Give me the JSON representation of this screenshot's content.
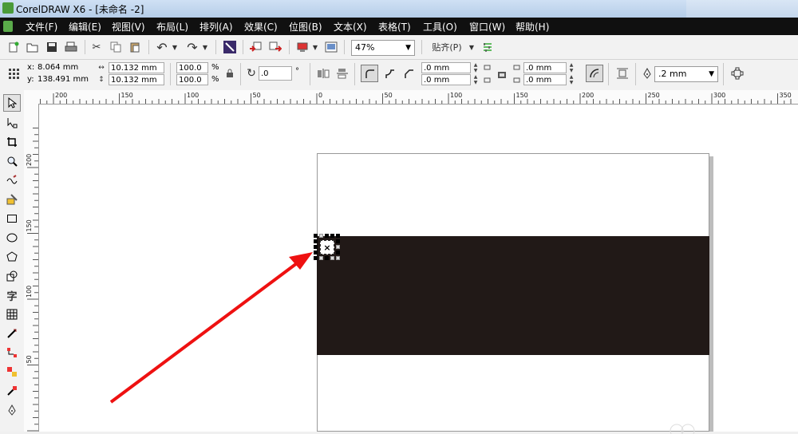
{
  "window": {
    "title": "CorelDRAW X6 - [未命名 -2]"
  },
  "menu": [
    "文件(F)",
    "编辑(E)",
    "视图(V)",
    "布局(L)",
    "排列(A)",
    "效果(C)",
    "位图(B)",
    "文本(X)",
    "表格(T)",
    "工具(O)",
    "窗口(W)",
    "帮助(H)"
  ],
  "toolbar": {
    "zoom": "47%",
    "snap_label": "贴齐(P)"
  },
  "property_bar": {
    "x_label": "x:",
    "x_value": "8.064 mm",
    "y_label": "y:",
    "y_value": "138.491 mm",
    "width_value": "10.132 mm",
    "height_value": "10.132 mm",
    "scale_x": "100.0",
    "scale_y": "100.0",
    "percent": "%",
    "rotation": ".0",
    "degree": "°",
    "corner_1": ".0 mm",
    "corner_2": ".0 mm",
    "corner_3": ".0 mm",
    "corner_4": ".0 mm",
    "outline_width": ".2 mm"
  },
  "ruler_h": [
    "200",
    "150",
    "100",
    "50",
    "0",
    "50",
    "100",
    "150",
    "200",
    "250",
    "300",
    "350"
  ],
  "ruler_v": [
    "200",
    "150",
    "100",
    "50"
  ],
  "selection_mark": "×",
  "colors": {
    "rectangle": "#211917",
    "arrow": "#ee1111"
  }
}
